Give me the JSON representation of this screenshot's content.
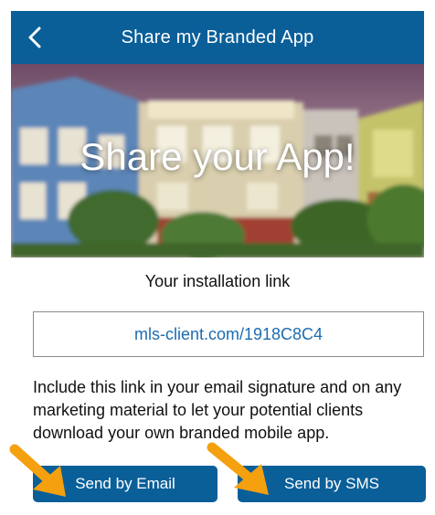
{
  "header": {
    "title": "Share my Branded App",
    "back_icon": "chevron-left-icon"
  },
  "hero": {
    "title": "Share your App!"
  },
  "install": {
    "label": "Your installation link",
    "link": "mls-client.com/1918C8C4"
  },
  "description": "Include this link in your email signature and on any marketing material to let your potential clients download your own branded mobile app.",
  "actions": {
    "email_label": "Send by Email",
    "sms_label": "Send by SMS"
  },
  "colors": {
    "primary": "#0a5f99",
    "link": "#1c6cb0",
    "annotation_arrow": "#f5a00f"
  }
}
